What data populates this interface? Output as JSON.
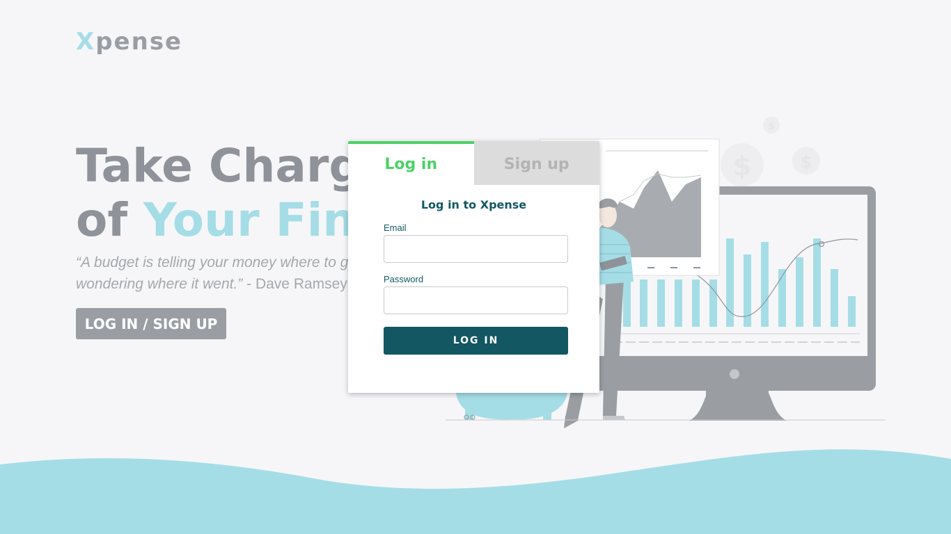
{
  "brand": {
    "logo_first": "X",
    "logo_rest": "pense"
  },
  "hero": {
    "title_line1": "Take Charge",
    "title_line2_prefix": "of ",
    "title_line2_accent": "Your Finances",
    "quote_text": "“A budget is telling your money where to go instead of",
    "quote_text_line2": "wondering where it went.”",
    "quote_author": " - Dave Ramsey",
    "cta_label": "LOG IN / SIGN UP"
  },
  "auth": {
    "tabs": [
      {
        "label": "Log in",
        "active": true
      },
      {
        "label": "Sign up",
        "active": false
      }
    ],
    "title": "Log in to Xpense",
    "email_label": "Email",
    "email_value": "",
    "password_label": "Password",
    "password_value": "",
    "submit_label": "LOG IN"
  },
  "colors": {
    "accent_teal": "#a5dde6",
    "brand_dark": "#135763",
    "active_green": "#4cd168",
    "muted_gray": "#9a9ea3",
    "background": "#f6f6f8"
  }
}
